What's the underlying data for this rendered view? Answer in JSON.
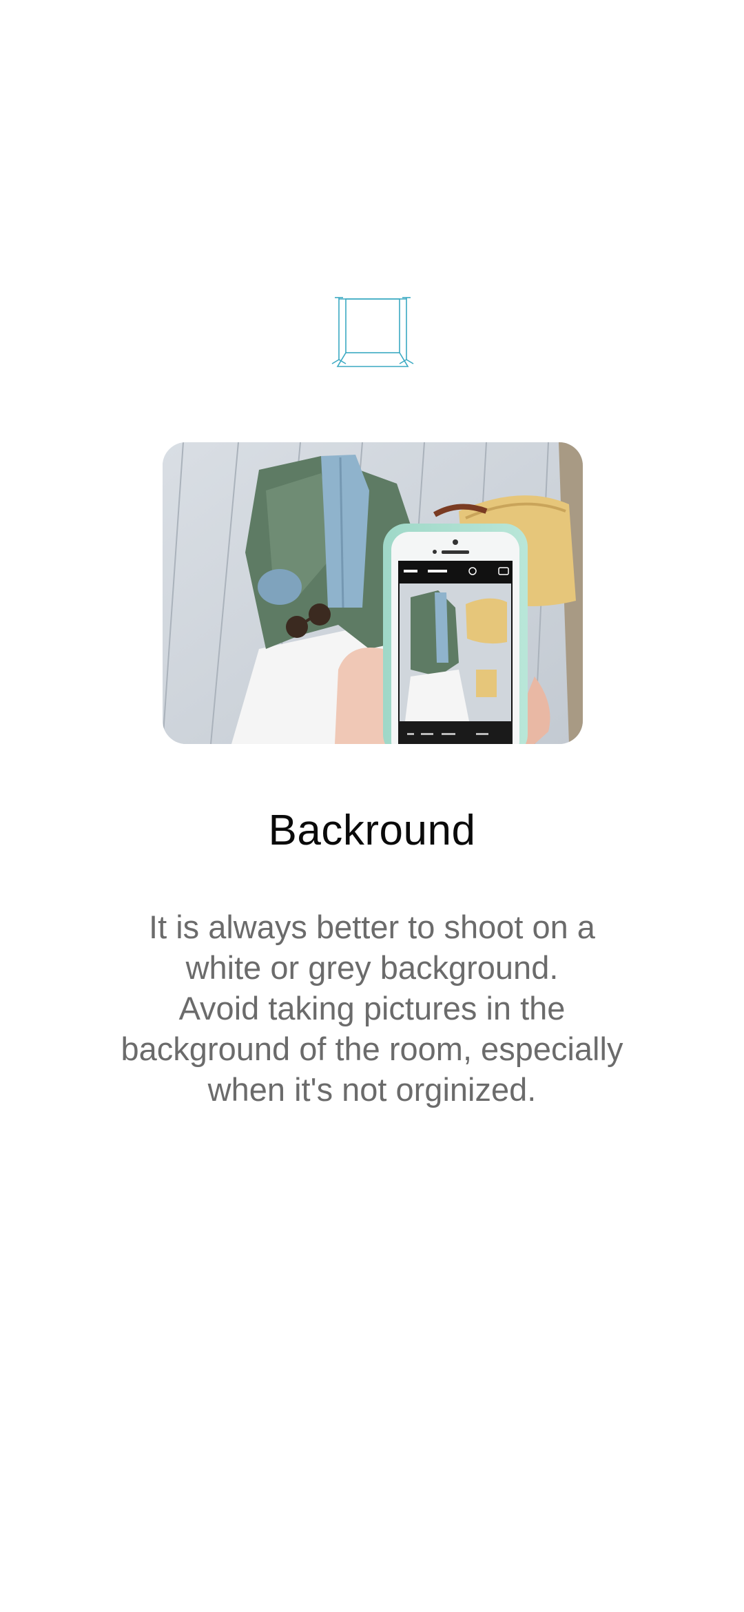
{
  "tip": {
    "title": "Backround",
    "description_lines": [
      "It is always better to shoot on a",
      "white or grey background.",
      "Avoid taking pictures in the",
      "background of the room, especially",
      "when it's not orginized."
    ]
  },
  "icons": {
    "header": "photo-backdrop-icon"
  },
  "colors": {
    "background": "#ffffff",
    "title": "#0a0a0a",
    "description": "#6b6b6b",
    "icon_stroke": "#3aa9c2"
  }
}
